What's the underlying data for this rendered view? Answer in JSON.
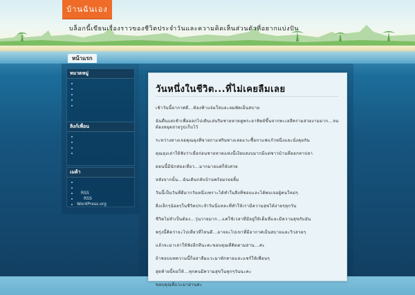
{
  "site": {
    "title": "บ้านฉันเอง",
    "description": "บล็อกนี้เขียนเรื่องราวของชีวิตประจำวันและความคิดเห็นส่วนตัวที่อยากแบ่งปัน"
  },
  "nav": {
    "home": "หน้าแรก"
  },
  "sidebar": {
    "w1": {
      "title": "หมวดหมู่",
      "items": [
        "",
        "",
        "",
        "",
        ""
      ]
    },
    "w2": {
      "title": "ลิงก์เพื่อน",
      "items": [
        "",
        "",
        "",
        ""
      ]
    },
    "w3": {
      "title": "เมต้า",
      "items": [
        "",
        "",
        "RSS",
        "RSS",
        "WordPress.org"
      ]
    }
  },
  "post": {
    "title": "วันหนึ่งในชีวิต...ที่ไม่เคยลืมเลย",
    "paragraphs": [
      "เช้าวันนี้อากาศดี...ท้องฟ้าแจ่มใสและลมพัดเย็นสบาย",
      "ฉันตื่นแต่เช้าเพื่อออกไปเดินเล่นริมชายหาดดูพระอาทิตย์ขึ้นจากทะเลสีครามสวยงามมาก...จนต้องหยุดถ่ายรูปเก็บไว้",
      "ระหว่างทางเจอคุณลุงที่ขายกาแฟริมทางเลยแวะซื้อกาแฟแก้วหนึ่งและนั่งคุยกัน",
      "คุณลุงเล่าให้ฟังว่าเมื่อก่อนชายหาดแห่งนี้เงียบสงบมากมีแต่ชาวบ้านที่ออกหาปลา",
      "ตอนนี้มีนักท่องเที่ยว...มากมายแต่ก็ยังสวย",
      "หลังจากนั้น...ฉันเดินกลับบ้านพร้อมรอยยิ้ม",
      "วันนี้เป็นวันที่ดีมากวันหนึ่งเพราะได้ทำในสิ่งที่ชอบและได้พบเจอผู้คนใหม่ๆ",
      "สิ่งเล็กๆน้อยๆในชีวิตประจำวันนี่แหละที่ทำให้เรามีความสุขได้ง่ายๆทุกวัน",
      "ชีวิตไม่จำเป็นต้อง...วุ่นวายมาก...แค่ใช้เวลาที่มีอยู่ให้เต็มที่และมีความสุขกับมัน",
      "พรุ่งนี้คิดว่าจะไปเที่ยวที่ไหนดี...อาจจะไปเขาที่มีอากาศเย็นสบายและวิวสวยๆ",
      "แล้วจะมาเล่าให้ฟังอีกทีนะคะขอบคุณที่ติดตามอ่าน...ค่ะ",
      "ถ้าชอบบทความนี้ก็อย่าลืมแวะมาทักทายและแชร์ให้เพื่อนๆ",
      "สุดท้ายนี้ขอให้...ทุกคนมีความสุขในทุกๆวันนะคะ",
      "ขอบคุณที่แวะมาอ่านค่ะ"
    ]
  },
  "colors": {
    "accent": "#ee6c28",
    "ocean": "#16557f"
  }
}
